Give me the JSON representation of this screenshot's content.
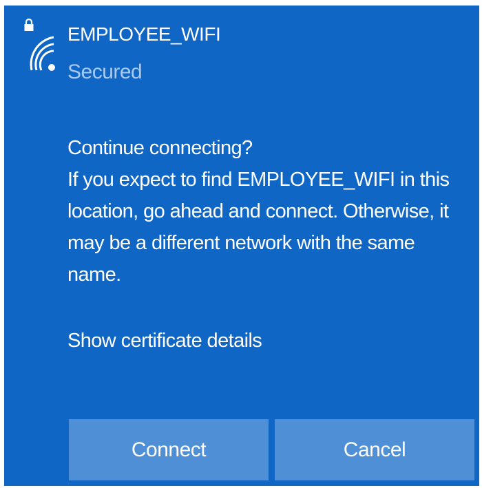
{
  "network": {
    "name": "EMPLOYEE_WIFI",
    "status": "Secured",
    "icon": "wifi-secured-icon"
  },
  "prompt": {
    "heading": "Continue connecting?",
    "body_lines": [
      "If you expect to find EMPLOYEE_WIFI in this",
      "location, go ahead and connect. Otherwise, it",
      "may be a different network with the same",
      "name."
    ],
    "certificate_link": "Show certificate details"
  },
  "buttons": {
    "connect": "Connect",
    "cancel": "Cancel"
  },
  "colors": {
    "panel_background": "#1066c4",
    "button_background": "#4e8fd6",
    "secondary_text": "#a9c9ef",
    "primary_text": "#ffffff"
  }
}
